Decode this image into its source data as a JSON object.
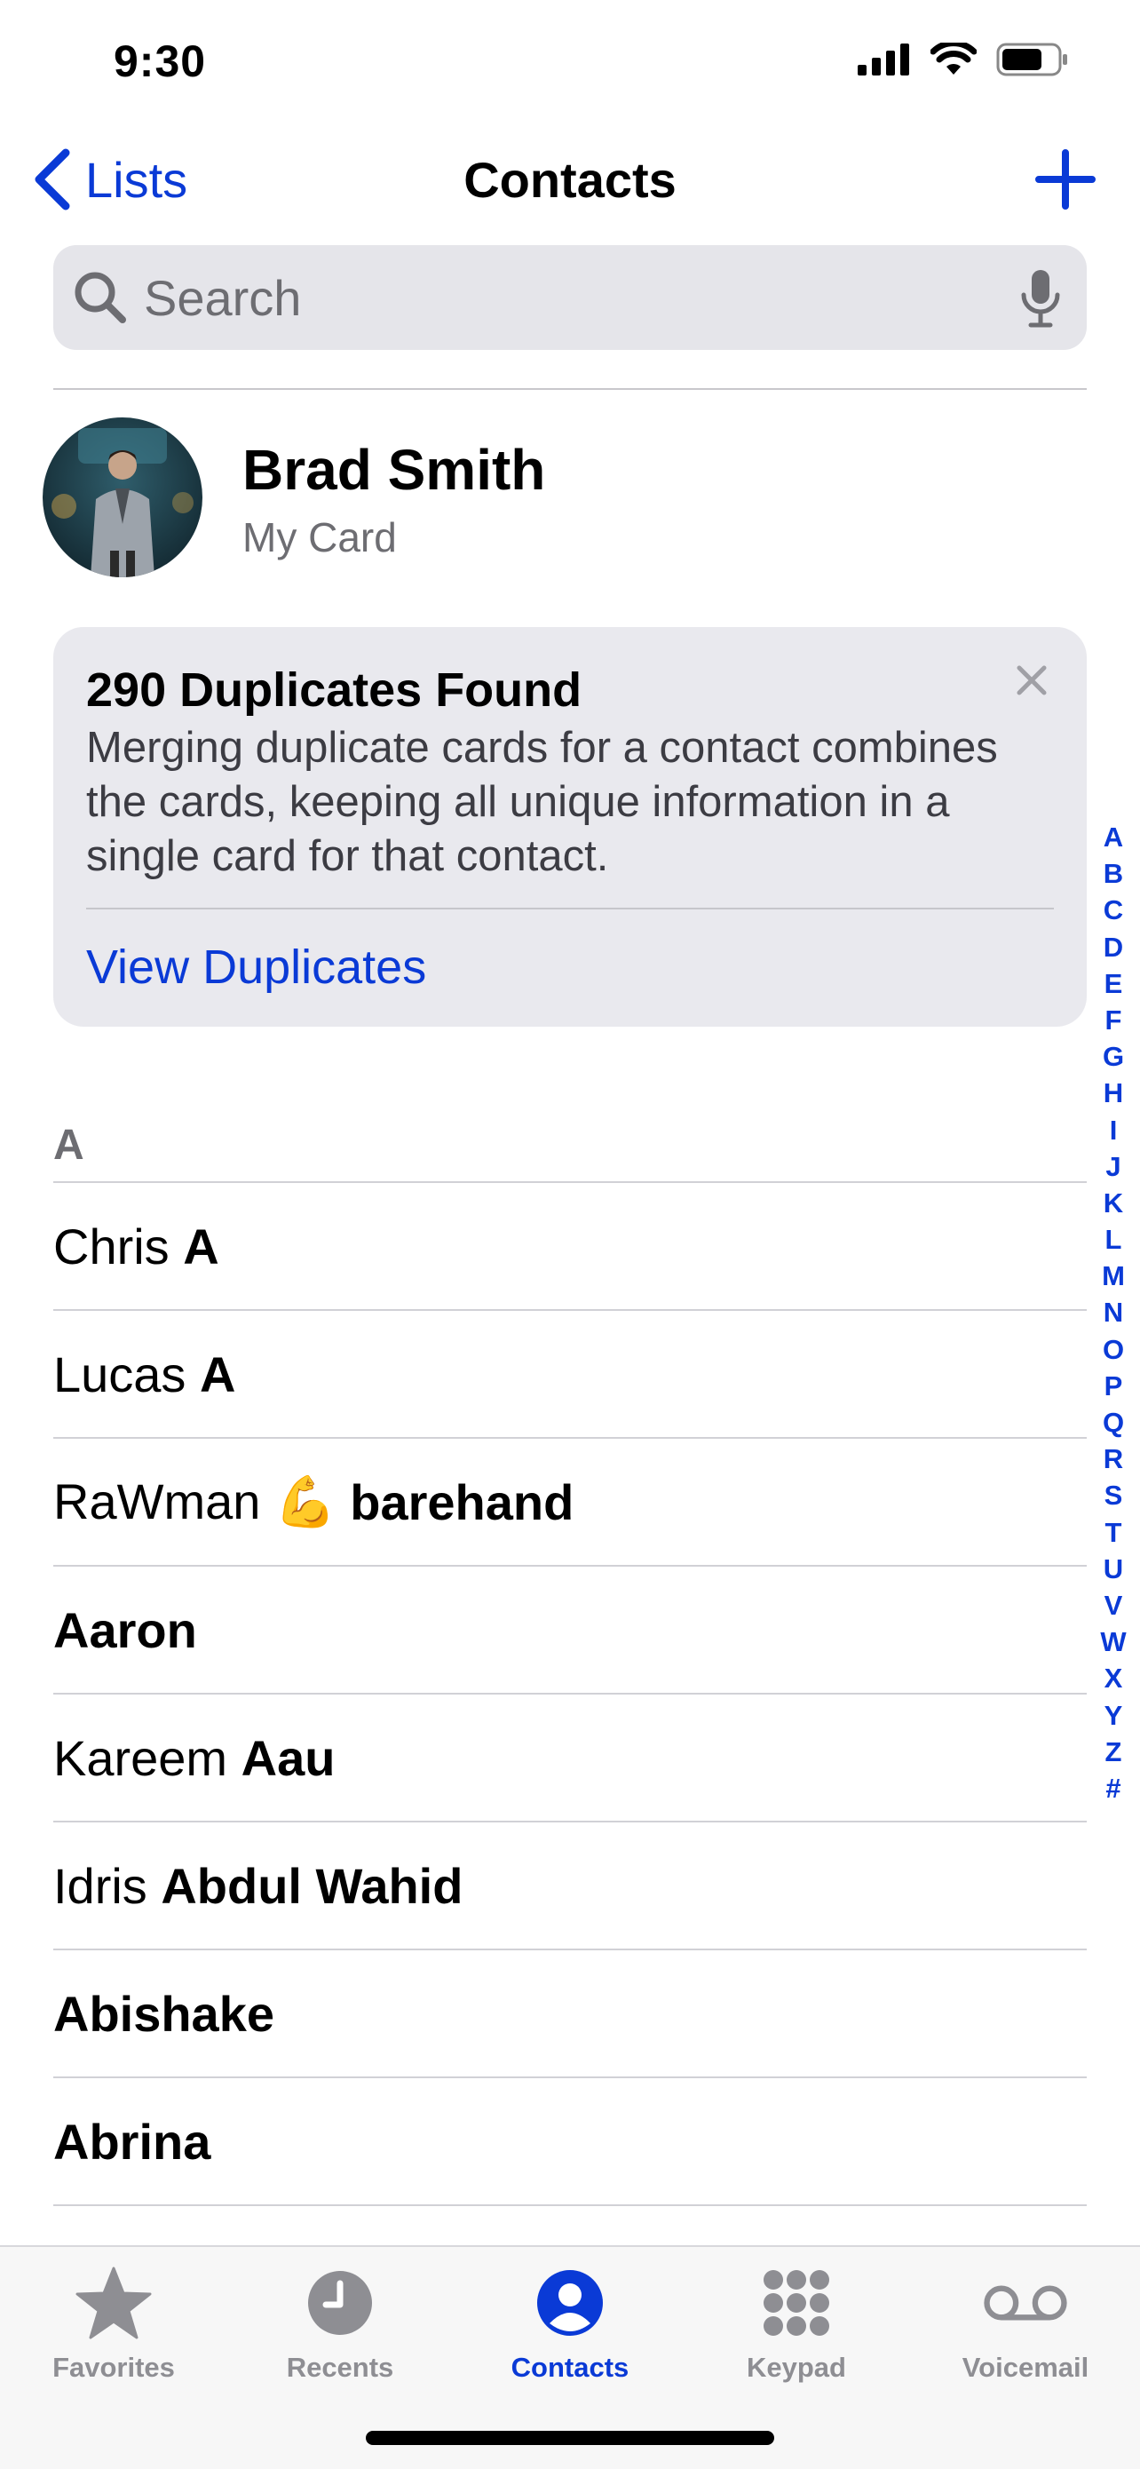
{
  "status": {
    "time": "9:30"
  },
  "nav": {
    "back_label": "Lists",
    "title": "Contacts"
  },
  "search": {
    "placeholder": "Search"
  },
  "my_card": {
    "name": "Brad Smith",
    "subtitle": "My Card"
  },
  "duplicates": {
    "title": "290 Duplicates Found",
    "body": "Merging duplicate cards for a contact combines the cards, keeping all unique information in a single card for that contact.",
    "link": "View Duplicates"
  },
  "section": {
    "header": "A"
  },
  "contacts": [
    {
      "first": "Chris",
      "last": "A"
    },
    {
      "first": "Lucas",
      "last": "A"
    },
    {
      "first": "RaWman 💪",
      "last": "barehand"
    },
    {
      "first": "",
      "last": "Aaron"
    },
    {
      "first": "Kareem ",
      "last": "Aau"
    },
    {
      "first": "Idris",
      "last": "Abdul Wahid"
    },
    {
      "first": "",
      "last": "Abishake"
    },
    {
      "first": "",
      "last": "Abrina"
    }
  ],
  "index_letters": [
    "A",
    "B",
    "C",
    "D",
    "E",
    "F",
    "G",
    "H",
    "I",
    "J",
    "K",
    "L",
    "M",
    "N",
    "O",
    "P",
    "Q",
    "R",
    "S",
    "T",
    "U",
    "V",
    "W",
    "X",
    "Y",
    "Z",
    "#"
  ],
  "tabs": [
    {
      "label": "Favorites",
      "icon": "star-icon",
      "active": false
    },
    {
      "label": "Recents",
      "icon": "clock-icon",
      "active": false
    },
    {
      "label": "Contacts",
      "icon": "person-circle-icon",
      "active": true
    },
    {
      "label": "Keypad",
      "icon": "keypad-icon",
      "active": false
    },
    {
      "label": "Voicemail",
      "icon": "voicemail-icon",
      "active": false
    }
  ],
  "colors": {
    "accent": "#0a3ad6",
    "inactive": "#8e8e93",
    "search_bg": "#e5e5ea",
    "card_bg": "#e9e9ee"
  }
}
